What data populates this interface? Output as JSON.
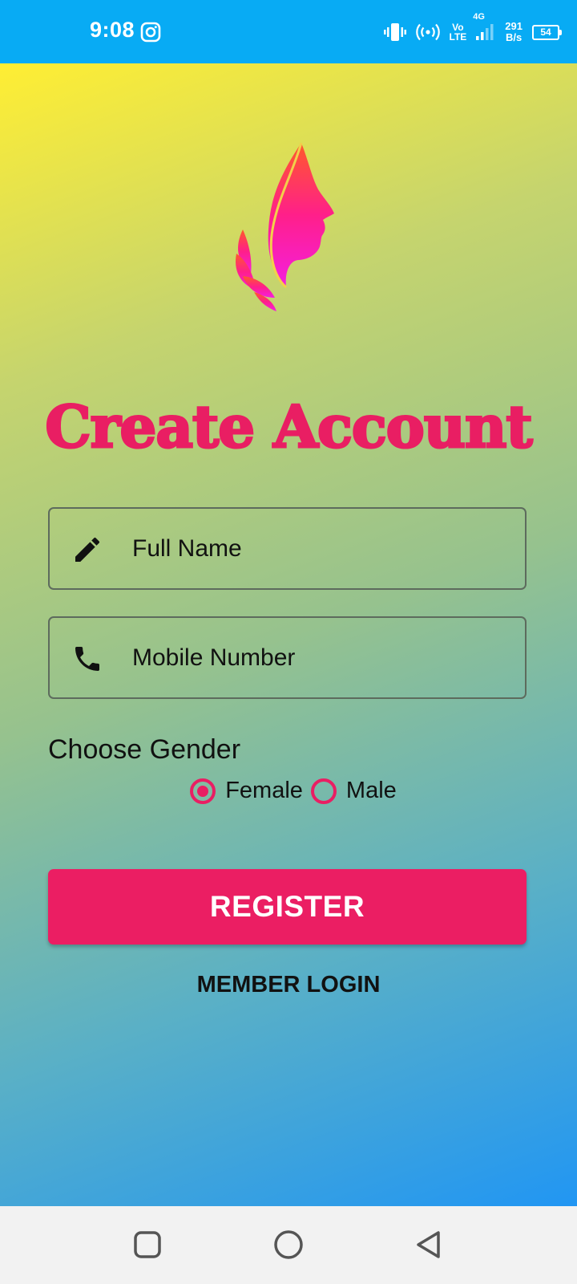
{
  "status_bar": {
    "time": "9:08",
    "network_top": "Vo",
    "network_bottom": "LTE",
    "network_type": "4G",
    "speed_value": "291",
    "speed_unit": "B/s",
    "battery": "54",
    "icons": [
      "instagram-icon",
      "vibrate-icon",
      "hotspot-icon",
      "signal-icon",
      "battery-icon"
    ]
  },
  "colors": {
    "accent": "#e91e63",
    "status_bar": "#08abf4",
    "gradient_top": "#ffee33",
    "gradient_bottom": "#2196f3"
  },
  "page": {
    "title": "Create Account",
    "logo_icon": "woman-face-logo"
  },
  "form": {
    "full_name": {
      "placeholder": "Full Name",
      "value": "",
      "icon": "pencil-icon"
    },
    "mobile": {
      "placeholder": "Mobile Number",
      "value": "",
      "icon": "phone-icon"
    },
    "gender_label": "Choose Gender",
    "gender_options": [
      {
        "label": "Female",
        "checked": true
      },
      {
        "label": "Male",
        "checked": false
      }
    ],
    "register_label": "REGISTER",
    "member_login_label": "MEMBER LOGIN"
  },
  "nav_bar": {
    "icons": [
      "recents-icon",
      "home-icon",
      "back-icon"
    ]
  }
}
